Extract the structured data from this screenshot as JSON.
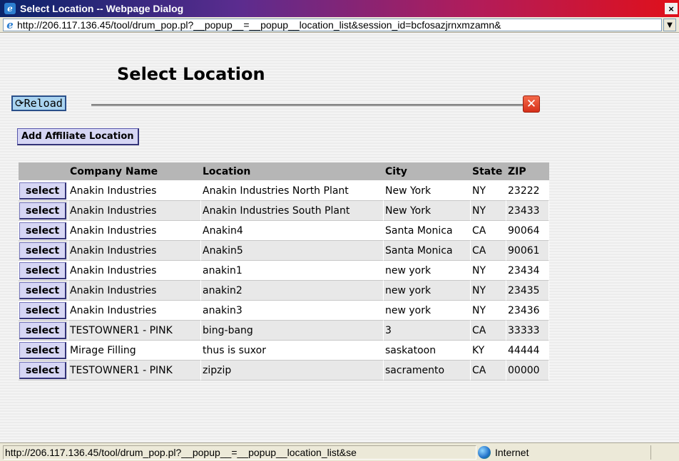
{
  "window": {
    "title": "Select Location -- Webpage Dialog",
    "close": "×",
    "address": "http://206.117.136.45/tool/drum_pop.pl?__popup__=__popup__location_list&session_id=bcfosazjrnxmzamn&"
  },
  "page": {
    "heading": "Select Location",
    "reload_label": "⟳Reload",
    "close_label": "✕",
    "add_affiliate_label": "Add Affiliate Location"
  },
  "table": {
    "headers": [
      "",
      "Company Name",
      "Location",
      "City",
      "State",
      "ZIP"
    ],
    "select_label": "select",
    "rows": [
      {
        "company": "Anakin Industries",
        "location": "Anakin Industries North Plant",
        "city": "New York",
        "state": "NY",
        "zip": "23222"
      },
      {
        "company": "Anakin Industries",
        "location": "Anakin Industries South Plant",
        "city": "New York",
        "state": "NY",
        "zip": "23433"
      },
      {
        "company": "Anakin Industries",
        "location": "Anakin4",
        "city": "Santa Monica",
        "state": "CA",
        "zip": "90064"
      },
      {
        "company": "Anakin Industries",
        "location": "Anakin5",
        "city": "Santa Monica",
        "state": "CA",
        "zip": "90061"
      },
      {
        "company": "Anakin Industries",
        "location": "anakin1",
        "city": "new york",
        "state": "NY",
        "zip": "23434"
      },
      {
        "company": "Anakin Industries",
        "location": "anakin2",
        "city": "new york",
        "state": "NY",
        "zip": "23435"
      },
      {
        "company": "Anakin Industries",
        "location": "anakin3",
        "city": "new york",
        "state": "NY",
        "zip": "23436"
      },
      {
        "company": "TESTOWNER1 - PINK",
        "location": "bing-bang",
        "city": "3",
        "state": "CA",
        "zip": "33333"
      },
      {
        "company": "Mirage Filling",
        "location": "thus is suxor",
        "city": "saskatoon",
        "state": "KY",
        "zip": "44444"
      },
      {
        "company": "TESTOWNER1 - PINK",
        "location": "zipzip",
        "city": "sacramento",
        "state": "CA",
        "zip": "00000"
      }
    ]
  },
  "status": {
    "url": "http://206.117.136.45/tool/drum_pop.pl?__popup__=__popup__location_list&se",
    "zone": "Internet"
  }
}
